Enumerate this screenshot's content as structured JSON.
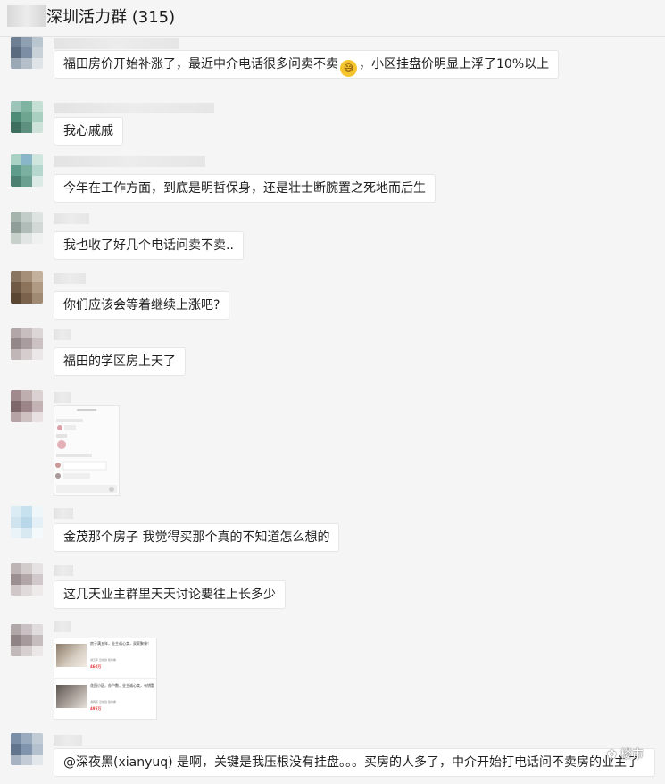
{
  "header": {
    "title": "深圳活力群 (315)"
  },
  "messages": [
    {
      "text_before": "福田房价开始补涨了，最近中介电话很多问卖不卖",
      "emoji": "sweat-smile-emoji",
      "text_after": "，小区挂盘价明显上浮了10%以上"
    },
    {
      "text": "我心戚戚"
    },
    {
      "text": "今年在工作方面，到底是明哲保身，还是壮士断腕置之死地而后生"
    },
    {
      "text": "我也收了好几个电话问卖不卖.."
    },
    {
      "text": "你们应该会等着继续上涨吧?"
    },
    {
      "text": "福田的学区房上天了"
    },
    {
      "type": "image",
      "description_icon": "chat-screenshot-image"
    },
    {
      "text": "金茂那个房子 我觉得买那个真的不知道怎么想的"
    },
    {
      "text": "这几天业主群里天天讨论要往上长多少"
    },
    {
      "type": "listing-image",
      "listings": [
        {
          "title": "房子满五年，业主诚心卖，双家聚餐！",
          "tags": [
            "满五年",
            "近地铁",
            "随时看"
          ],
          "price": "460万"
        },
        {
          "title": "花园小区，办户数，业主诚心卖，有钥匙",
          "tags": [
            "满两年",
            "近地铁",
            "随时看"
          ],
          "price": "495万"
        }
      ]
    },
    {
      "text": "@深夜黑(xianyuq) 是啊，关键是我压根没有挂盘。。。买房的人多了，中介开始打电话问不卖房的业主了"
    }
  ],
  "watermark": {
    "text": "楼市",
    "icon": "wechat-icon"
  },
  "colors": {
    "background": "#f5f5f5",
    "bubble": "#ffffff",
    "bubble_border": "#e6e6e6"
  }
}
